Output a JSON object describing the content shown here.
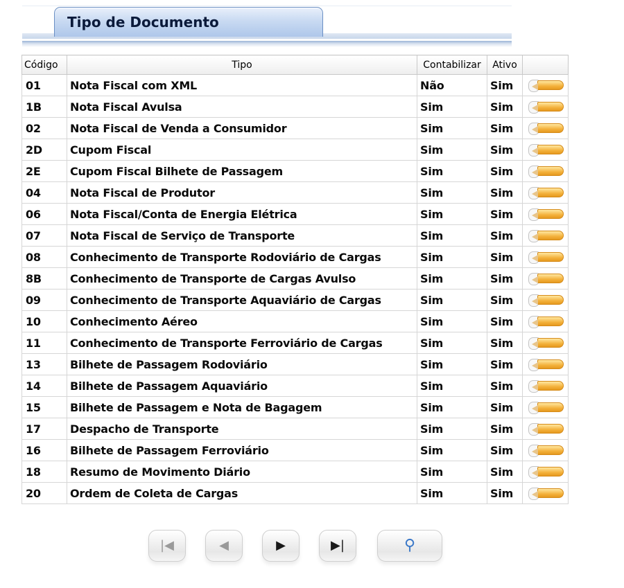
{
  "page": {
    "title": "Tipo de Documento"
  },
  "table": {
    "headers": {
      "codigo": "Código",
      "tipo": "Tipo",
      "contabilizar": "Contabilizar",
      "ativo": "Ativo"
    },
    "rows": [
      {
        "codigo": "01",
        "tipo": "Nota Fiscal com XML",
        "contabilizar": "Não",
        "ativo": "Sim"
      },
      {
        "codigo": "1B",
        "tipo": "Nota Fiscal Avulsa",
        "contabilizar": "Sim",
        "ativo": "Sim"
      },
      {
        "codigo": "02",
        "tipo": "Nota Fiscal de Venda a Consumidor",
        "contabilizar": "Sim",
        "ativo": "Sim"
      },
      {
        "codigo": "2D",
        "tipo": "Cupom Fiscal",
        "contabilizar": "Sim",
        "ativo": "Sim"
      },
      {
        "codigo": "2E",
        "tipo": "Cupom Fiscal Bilhete de Passagem",
        "contabilizar": "Sim",
        "ativo": "Sim"
      },
      {
        "codigo": "04",
        "tipo": "Nota Fiscal de Produtor",
        "contabilizar": "Sim",
        "ativo": "Sim"
      },
      {
        "codigo": "06",
        "tipo": "Nota Fiscal/Conta de Energia Elétrica",
        "contabilizar": "Sim",
        "ativo": "Sim"
      },
      {
        "codigo": "07",
        "tipo": "Nota Fiscal de Serviço de Transporte",
        "contabilizar": "Sim",
        "ativo": "Sim"
      },
      {
        "codigo": "08",
        "tipo": "Conhecimento de Transporte Rodoviário de Cargas",
        "contabilizar": "Sim",
        "ativo": "Sim"
      },
      {
        "codigo": "8B",
        "tipo": "Conhecimento de Transporte de Cargas Avulso",
        "contabilizar": "Sim",
        "ativo": "Sim"
      },
      {
        "codigo": "09",
        "tipo": "Conhecimento de Transporte Aquaviário de Cargas",
        "contabilizar": "Sim",
        "ativo": "Sim"
      },
      {
        "codigo": "10",
        "tipo": "Conhecimento Aéreo",
        "contabilizar": "Sim",
        "ativo": "Sim"
      },
      {
        "codigo": "11",
        "tipo": "Conhecimento de Transporte Ferroviário de Cargas",
        "contabilizar": "Sim",
        "ativo": "Sim"
      },
      {
        "codigo": "13",
        "tipo": "Bilhete de Passagem Rodoviário",
        "contabilizar": "Sim",
        "ativo": "Sim"
      },
      {
        "codigo": "14",
        "tipo": "Bilhete de Passagem Aquaviário",
        "contabilizar": "Sim",
        "ativo": "Sim"
      },
      {
        "codigo": "15",
        "tipo": "Bilhete de Passagem e Nota de Bagagem",
        "contabilizar": "Sim",
        "ativo": "Sim"
      },
      {
        "codigo": "17",
        "tipo": "Despacho de Transporte",
        "contabilizar": "Sim",
        "ativo": "Sim"
      },
      {
        "codigo": "16",
        "tipo": "Bilhete de Passagem Ferroviário",
        "contabilizar": "Sim",
        "ativo": "Sim"
      },
      {
        "codigo": "18",
        "tipo": "Resumo de Movimento Diário",
        "contabilizar": "Sim",
        "ativo": "Sim"
      },
      {
        "codigo": "20",
        "tipo": "Ordem de Coleta de Cargas",
        "contabilizar": "Sim",
        "ativo": "Sim"
      }
    ],
    "row_action_icon": "edit-pencil-icon"
  },
  "pager": {
    "buttons": [
      {
        "name": "first-page-button",
        "icon": "first-page-icon",
        "glyph": "|◀",
        "enabled": false
      },
      {
        "name": "prev-page-button",
        "icon": "prev-page-icon",
        "glyph": "◀",
        "enabled": false
      },
      {
        "name": "next-page-button",
        "icon": "next-page-icon",
        "glyph": "▶",
        "enabled": true
      },
      {
        "name": "last-page-button",
        "icon": "last-page-icon",
        "glyph": "▶|",
        "enabled": true
      },
      {
        "name": "search-button",
        "icon": "magnifier-icon",
        "glyph": "⚲",
        "enabled": true
      }
    ]
  },
  "colors": {
    "tab_border": "#6a8fc4",
    "tab_fill": "#c9daf2",
    "pencil": "#f4b23c"
  }
}
